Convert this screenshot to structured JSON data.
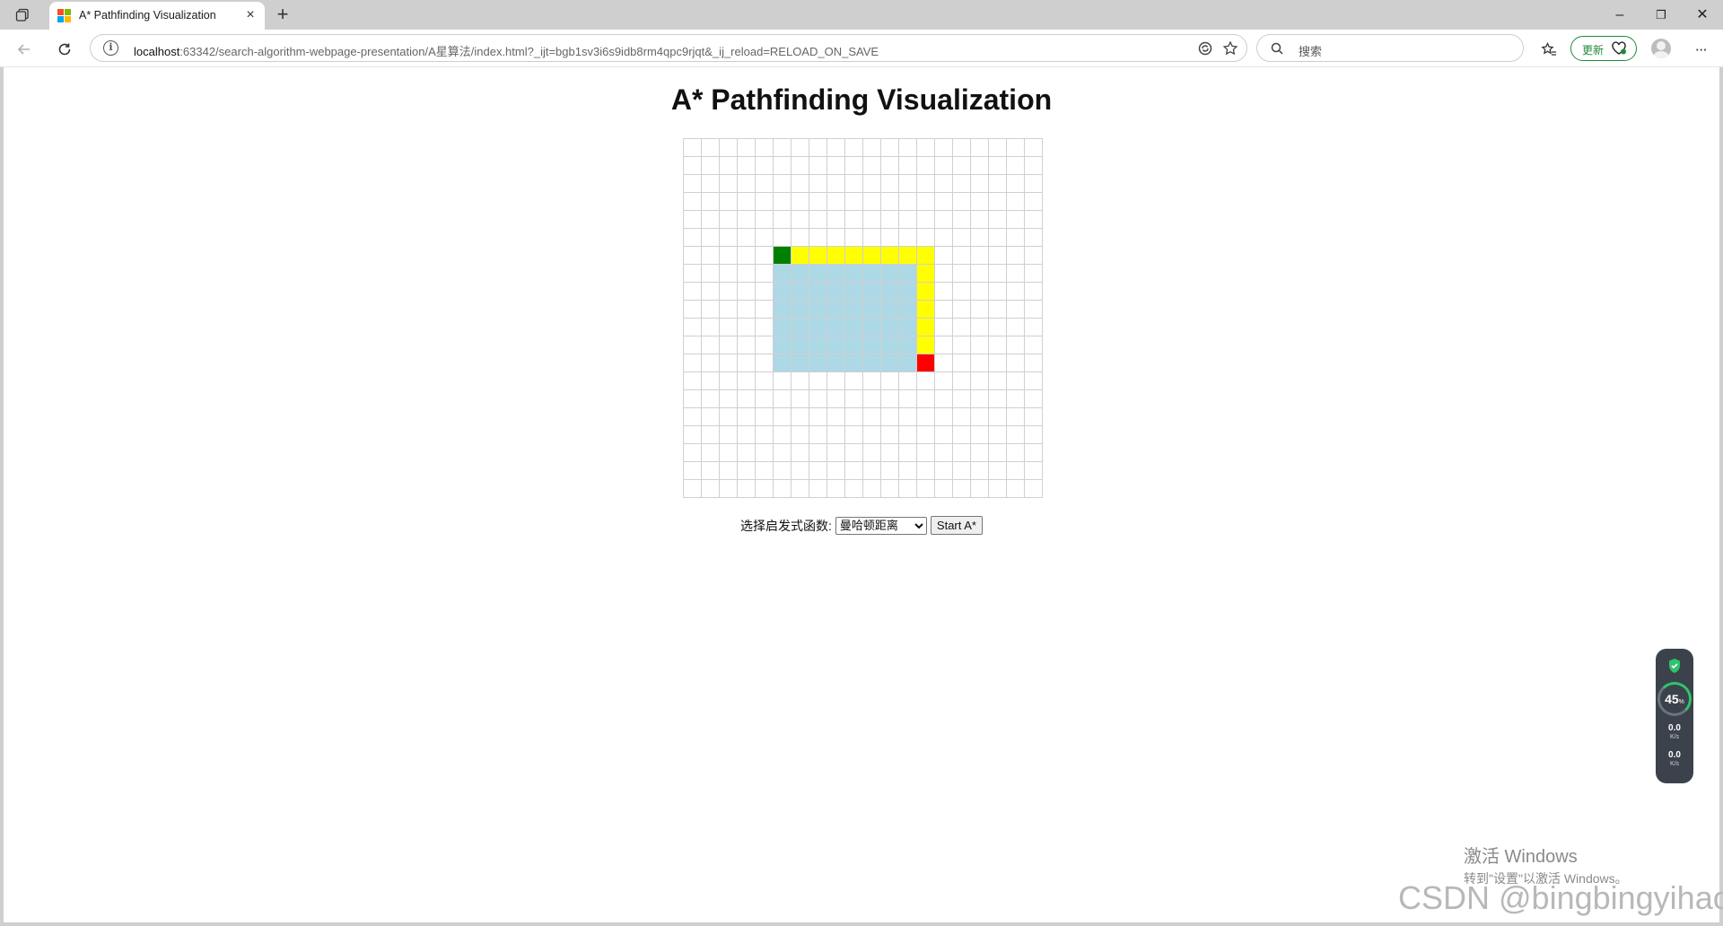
{
  "browser": {
    "tab": {
      "title": "A* Pathfinding Visualization",
      "close_glyph": "×"
    },
    "new_tab_glyph": "+",
    "window_controls": {
      "minimize": "–",
      "restore": "❐",
      "close": "✕"
    },
    "address": {
      "host": "localhost",
      "rest": ":63342/search-algorithm-webpage-presentation/A星算法/index.html?_ijt=bgb1sv3i6s9idb8rm4qpc9rjqt&_ij_reload=RELOAD_ON_SAVE"
    },
    "search": {
      "placeholder": "搜索"
    },
    "update_label": "更新",
    "more_glyph": "···"
  },
  "page": {
    "title": "A* Pathfinding Visualization",
    "heuristic_label": "选择启发式函数:",
    "heuristic_selected": "曼哈顿距离",
    "start_button": "Start A*"
  },
  "grid": {
    "rows": 20,
    "cols": 20,
    "colors": {
      "empty": "#ffffff",
      "start": "#008000",
      "end": "#ff0000",
      "path": "#ffff00",
      "wall": "#add8e6"
    },
    "start": [
      6,
      5
    ],
    "end": [
      12,
      13
    ],
    "path": [
      [
        6,
        6
      ],
      [
        6,
        7
      ],
      [
        6,
        8
      ],
      [
        6,
        9
      ],
      [
        6,
        10
      ],
      [
        6,
        11
      ],
      [
        6,
        12
      ],
      [
        6,
        13
      ],
      [
        7,
        13
      ],
      [
        8,
        13
      ],
      [
        9,
        13
      ],
      [
        10,
        13
      ],
      [
        11,
        13
      ]
    ],
    "walls": {
      "row_from": 7,
      "row_to": 12,
      "col_from": 5,
      "col_to": 12
    }
  },
  "widget": {
    "percent": "45",
    "percent_unit": "%",
    "up_speed": "0.0",
    "down_speed": "0.0",
    "speed_unit": "K/s"
  },
  "watermark": {
    "activate_title": "激活 Windows",
    "activate_sub": "转到\"设置\"以激活 Windows。",
    "csdn": "CSDN @bingbingyihao"
  }
}
